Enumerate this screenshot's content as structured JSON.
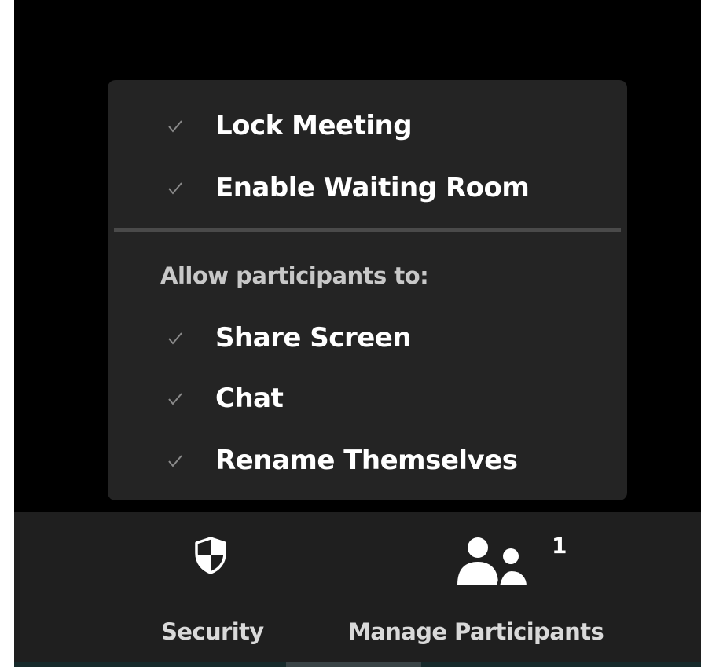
{
  "security_menu": {
    "items_top": [
      {
        "label": "Lock Meeting",
        "checked": true
      },
      {
        "label": "Enable Waiting Room",
        "checked": true
      }
    ],
    "section_header": "Allow participants to:",
    "items_bottom": [
      {
        "label": "Share Screen",
        "checked": true
      },
      {
        "label": "Chat",
        "checked": true
      },
      {
        "label": "Rename Themselves",
        "checked": true
      }
    ]
  },
  "toolbar": {
    "security_label": "Security",
    "security_icon": "shield-icon",
    "participants_label": "Manage Participants",
    "participants_icon": "participants-icon",
    "participants_count": "1"
  },
  "colors": {
    "background": "#000000",
    "menu_background": "#242424",
    "toolbar_background": "#1f1f1f",
    "text": "#ffffff",
    "check": "#8a8a8a"
  }
}
